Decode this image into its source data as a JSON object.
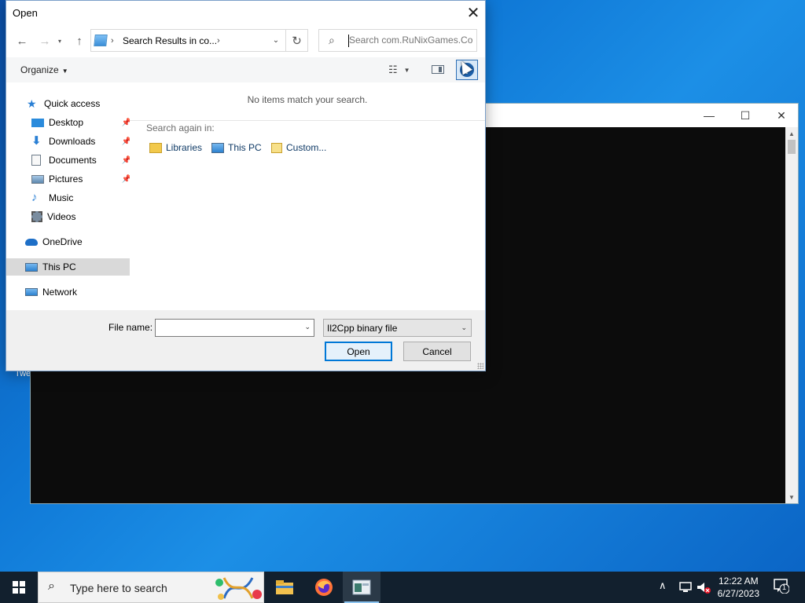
{
  "dialog": {
    "title": "Open",
    "address": {
      "text": "Search Results in co..."
    },
    "search": {
      "placeholder": "Search com.RuNixGames.Co"
    },
    "toolbar": {
      "organize": "Organize"
    },
    "nav": {
      "quick_access": "Quick access",
      "desktop": "Desktop",
      "downloads": "Downloads",
      "documents": "Documents",
      "pictures": "Pictures",
      "music": "Music",
      "videos": "Videos",
      "onedrive": "OneDrive",
      "this_pc": "This PC",
      "network": "Network"
    },
    "content": {
      "empty_message": "No items match your search.",
      "search_again": "Search again in:",
      "locations": [
        "Libraries",
        "This PC",
        "Custom..."
      ]
    },
    "filename_label": "File name:",
    "filename_value": "",
    "filetype": "Il2Cpp binary file",
    "open_label": "Open",
    "cancel_label": "Cancel"
  },
  "desktop": {
    "partial_icon_label": "Twe"
  },
  "taskbar": {
    "search_placeholder": "Type here to search",
    "time": "12:22 AM",
    "date": "6/27/2023",
    "notification_count": "1"
  },
  "icons": {
    "start": "windows-logo-icon",
    "search": "search-icon",
    "explorer": "folder-icon",
    "firefox": "firefox-icon",
    "console_app": "console-app-icon"
  },
  "colors": {
    "accent": "#0078d7",
    "taskbar": "#12202e",
    "selection": "#d9d9d9"
  }
}
